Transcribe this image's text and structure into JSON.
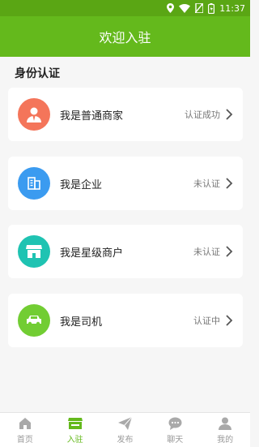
{
  "status_bar": {
    "time": "11:37"
  },
  "header": {
    "title": "欢迎入驻"
  },
  "section": {
    "title": "身份认证"
  },
  "cards": [
    {
      "label": "我是普通商家",
      "status": "认证成功",
      "icon": "person-icon",
      "color": "#f4755a"
    },
    {
      "label": "我是企业",
      "status": "未认证",
      "icon": "building-icon",
      "color": "#3b9bf0"
    },
    {
      "label": "我是星级商户",
      "status": "未认证",
      "icon": "shop-icon",
      "color": "#1fc3b2"
    },
    {
      "label": "我是司机",
      "status": "认证中",
      "icon": "car-icon",
      "color": "#72cd33"
    }
  ],
  "tabs": [
    {
      "label": "首页",
      "icon": "home-icon",
      "active": false
    },
    {
      "label": "入驻",
      "icon": "store-icon",
      "active": true
    },
    {
      "label": "发布",
      "icon": "send-icon",
      "active": false
    },
    {
      "label": "聊天",
      "icon": "chat-icon",
      "active": false
    },
    {
      "label": "我的",
      "icon": "user-icon",
      "active": false
    }
  ],
  "colors": {
    "primary": "#64b91c",
    "status_bar": "#5aa614",
    "inactive": "#9a9a9a"
  }
}
